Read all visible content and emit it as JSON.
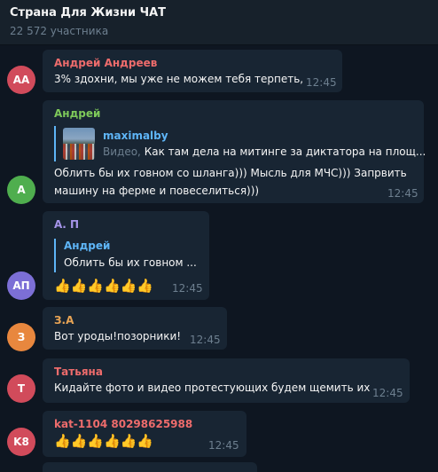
{
  "header": {
    "title": "Страна Для Жизни ЧАТ",
    "subtitle": "22 572 участника"
  },
  "messages": [
    {
      "initials": "АА",
      "avatar_color": "#d14b5b",
      "sender": "Андрей Андреев",
      "sender_color": "#ee6c6c",
      "lines": [
        "3% здохни, мы уже не можем тебя терпеть,"
      ],
      "time": "12:45"
    },
    {
      "initials": "А",
      "avatar_color": "#4fae4e",
      "sender": "Андрей",
      "sender_color": "#7ec95a",
      "reply": {
        "name": "maximalby",
        "media_label": "Видео,",
        "text": " Как там дела на митинге за диктатора на площ..."
      },
      "lines": [
        "Облить бы их говном со шланга))) Мысль для МЧС))) Запрвить",
        "машину на ферме и повеселиться)))"
      ],
      "time": "12:45"
    },
    {
      "initials": "АП",
      "avatar_color": "#7c6fd6",
      "sender": "А. П",
      "sender_color": "#a695ea",
      "reply": {
        "name": "Андрей",
        "text": "Облить бы их говном ..."
      },
      "emoji": "👍👍👍👍👍👍",
      "time": "12:45"
    },
    {
      "initials": "З",
      "avatar_color": "#e8873e",
      "sender": "З.А",
      "sender_color": "#e8a455",
      "lines": [
        "Вот уроды!позорники!"
      ],
      "time": "12:45"
    },
    {
      "initials": "Т",
      "avatar_color": "#d14b5b",
      "sender": "Татьяна",
      "sender_color": "#ee6c6c",
      "lines": [
        "Кидайте фото и видео протестующих будем щемить их"
      ],
      "time": "12:45"
    },
    {
      "initials": "K8",
      "avatar_color": "#d14b5b",
      "sender": "kat-1104 80298625988",
      "sender_color": "#ee6c6c",
      "emoji": "👍👍👍👍👍👍",
      "time": "12:45"
    }
  ]
}
